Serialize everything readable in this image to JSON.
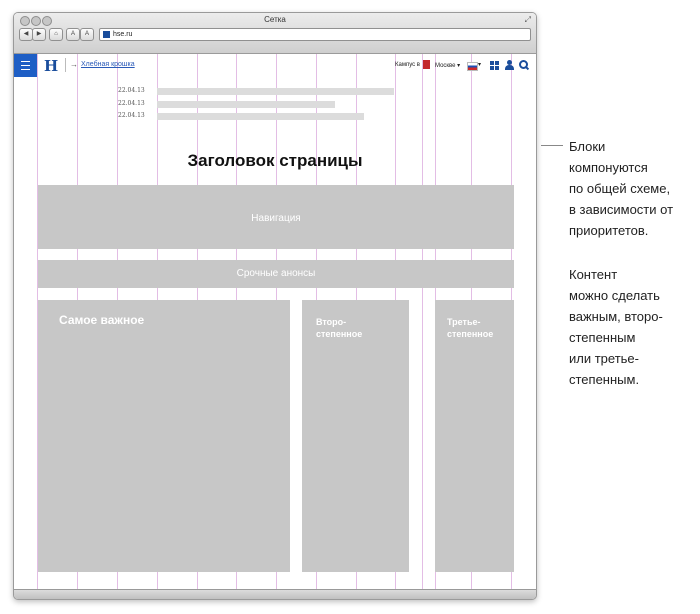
{
  "window": {
    "title": "Сетка",
    "url": "hse.ru"
  },
  "toolbar": {
    "back": "◀",
    "forward": "▶",
    "home": "⌂",
    "font_small": "A",
    "font_large": "A"
  },
  "header": {
    "breadcrumb_arrow": "→",
    "breadcrumb": "Хлебная крошка",
    "campus_label": "Кампус в",
    "city": "Москве",
    "city_caret": "▾",
    "lang_caret": "▾"
  },
  "news": [
    {
      "date": "22.04.13"
    },
    {
      "date": "22.04.13"
    },
    {
      "date": "22.04.13"
    }
  ],
  "page_title": "Заголовок страницы",
  "blocks": {
    "navigation": "Навигация",
    "urgent": "Срочные анонсы",
    "primary": "Самое важное",
    "secondary": "Второ-\nстепенное",
    "tertiary": "Третье-\nстепенное"
  },
  "annotation": {
    "paragraph1": "Блоки\nкомпонуются\nпо общей схеме,\nв зависимости от\nприоритетов.",
    "paragraph2": "Контент\nможно сделать\nважным, второ-\nстепенным\nили третье-\nстепенным."
  },
  "colors": {
    "brand": "#1e5ec5",
    "block": "#c7c7c7",
    "grid": "#e3bde5"
  }
}
